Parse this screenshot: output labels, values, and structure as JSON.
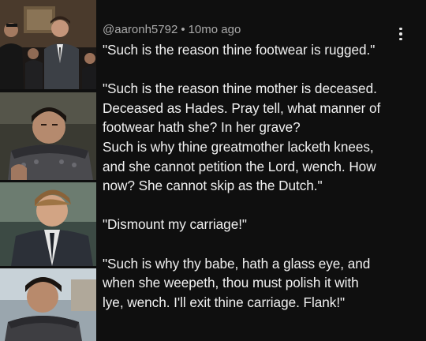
{
  "comment": {
    "author": "@aaronh5792",
    "separator": "•",
    "timestamp": "10mo ago",
    "paragraphs": [
      "\"Such is the reason thine footwear is rugged.\"",
      "\"Such is the reason thine mother is deceased.\nDeceased as Hades. Pray tell, what manner of\nfootwear hath she? In her grave?\nSuch is why thine greatmother lacketh knees,\nand she cannot petition the Lord, wench. How\nnow? She cannot skip as the Dutch.\"",
      "\"Dismount my carriage!\"",
      "\"Such is why thy babe, hath a glass eye, and\nwhen she weepeth, thou must polish it with\nlye, wench. I'll exit thine carriage. Flank!\""
    ]
  },
  "icons": {
    "more": "more-vertical-icon"
  },
  "colors": {
    "background": "#0f0f0f",
    "text": "#f1f1f1",
    "meta": "#aaaaaa"
  }
}
